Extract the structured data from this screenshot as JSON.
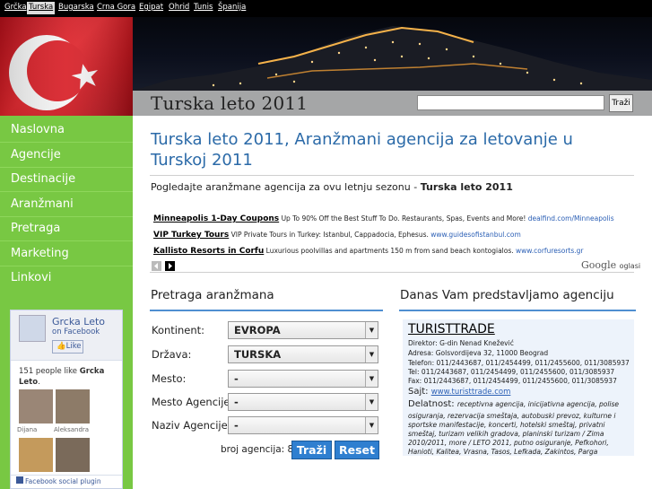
{
  "topnav": [
    {
      "label": "Grčka",
      "active": false
    },
    {
      "label": "Turska",
      "active": true
    },
    {
      "label": "Bugarska",
      "active": false
    },
    {
      "label": "Crna Gora",
      "active": false
    },
    {
      "label": "Egipat",
      "active": false
    },
    {
      "label": "Ohrid",
      "active": false
    },
    {
      "label": "Tunis",
      "active": false
    },
    {
      "label": "Španija",
      "active": false
    }
  ],
  "header": {
    "site_title": "Turska leto 2011",
    "search_button": "Traži",
    "search_value": ""
  },
  "sidebar": {
    "items": [
      {
        "label": "Naslovna"
      },
      {
        "label": "Agencije"
      },
      {
        "label": "Destinacije"
      },
      {
        "label": "Aranžmani"
      },
      {
        "label": "Pretraga"
      },
      {
        "label": "Marketing"
      },
      {
        "label": "Linkovi"
      }
    ],
    "facebook": {
      "page_name": "Grcka Leto",
      "on_facebook": "on Facebook",
      "like_button": "Like",
      "likes_text": "151 people like",
      "likes_name": "Grcka Leto",
      "likes_suffix": ".",
      "fans": [
        "Dijana",
        "Aleksandra"
      ],
      "footer": "Facebook social plugin"
    }
  },
  "main": {
    "heading": "Turska leto 2011, Aranžmani agencija za letovanje u Turskoj 2011",
    "intro_text": "Pogledajte aranžmane agencija za ovu letnju sezonu - ",
    "intro_bold": "Turska leto 2011",
    "ads": [
      {
        "title": "Minneapolis 1-Day Coupons",
        "text": "Up To 90% Off the Best Stuff To Do. Restaurants, Spas, Events and More!",
        "url": "dealfind.com/Minneapolis"
      },
      {
        "title": "VIP Turkey Tours",
        "text": "VIP Private Tours in Turkey: Istanbul, Cappadocia, Ephesus.",
        "url": "www.guidesofistanbul.com"
      },
      {
        "title": "Kallisto Resorts in Corfu",
        "text": "Luxurious poolvillas and apartments 150 m from sand beach kontogialos.",
        "url": "www.corfuresorts.gr"
      }
    ],
    "google_ads": "Google",
    "google_ads_suffix": "oglasi"
  },
  "search_panel": {
    "title": "Pretraga aranžmana",
    "fields": [
      {
        "label": "Kontinent:",
        "value": "EVROPA"
      },
      {
        "label": "Država:",
        "value": "TURSKA"
      },
      {
        "label": "Mesto:",
        "value": "-"
      },
      {
        "label": "Mesto Agencije:",
        "value": "-"
      },
      {
        "label": "Naziv Agencije:",
        "value": "-"
      }
    ],
    "count_text": "broj agencija: 80",
    "search_button": "Traži",
    "reset_button": "Reset"
  },
  "agency_panel": {
    "title": "Danas Vam predstavljamo agenciju",
    "name": "TURISTTRADE",
    "director": "Direktor: G-din Nenad Knežević",
    "address": "Adresa: Golsvordijeva 32, 11000 Beograd",
    "phone_1": "Telefon: 011/2443687, 011/2454499, 011/2455600, 011/3085937",
    "phone_2": "Tel: 011/2443687, 011/2454499, 011/2455600, 011/3085937",
    "fax": "Fax: 011/2443687, 011/2454499, 011/2455600, 011/3085937",
    "site_label": "Sajt: ",
    "site_url": "www.turisttrade.com",
    "activity_label": "Delatnost: ",
    "activity_lines": [
      "receptivna agencija, inicijativna agencija, polise",
      "osiguranja, rezervacija smeštaja, autobuski prevoz, kulturne i",
      "sportske manifestacije, koncerti, hotelski smeštaj, privatni",
      "smeštaj, turizam velikih gradova, planinski turizam / Zima",
      "2010/2011, more / LETO 2011, putno osiguranje, Pefkohori,",
      "Hanioti, Kalitea, Vrasna, Tasos, Lefkada, Zakintos, Parga"
    ]
  },
  "colors": {
    "sidebar_green": "#78c843",
    "link_blue": "#2b6aa8",
    "button_blue": "#2f7fd0",
    "flag_red": "#e0242b"
  }
}
